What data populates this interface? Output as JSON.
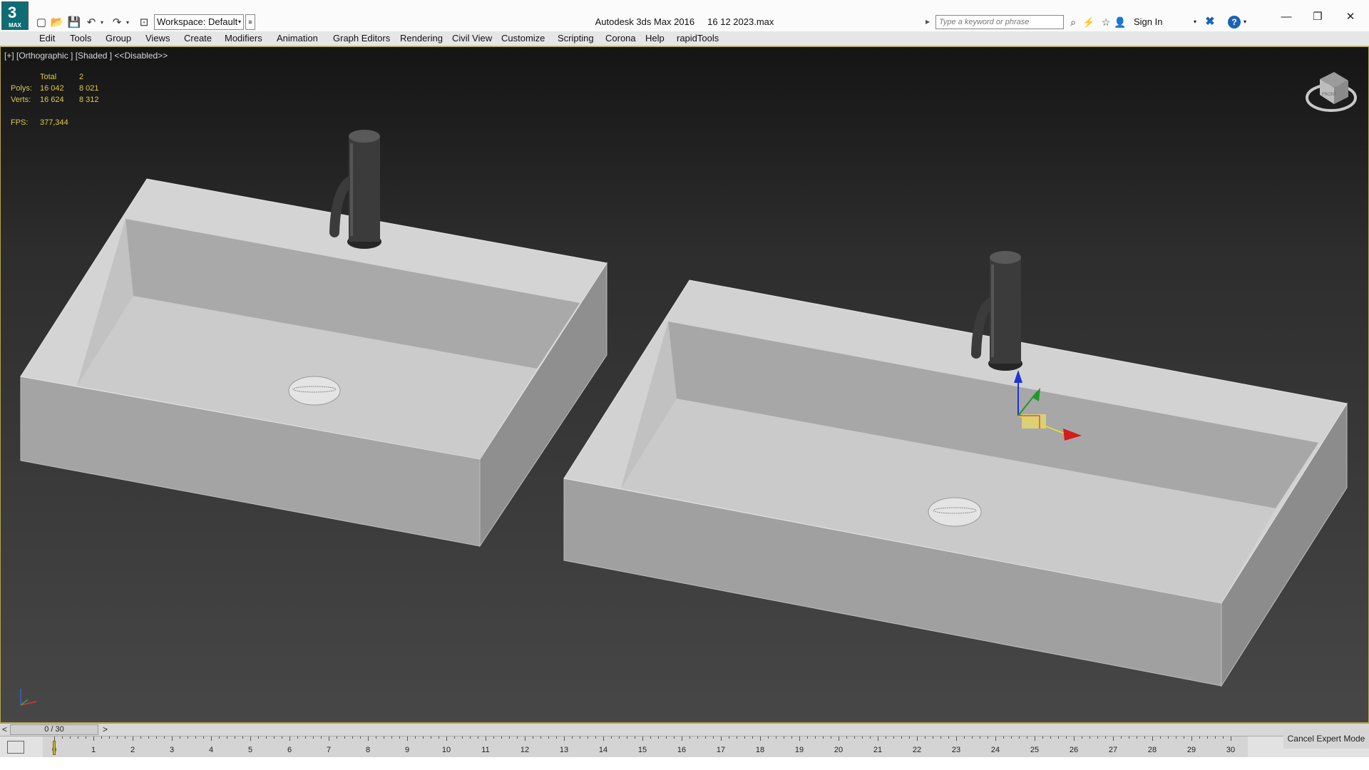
{
  "app": {
    "logo_symbol": "3",
    "logo_text": "MAX",
    "title_app": "Autodesk 3ds Max 2016",
    "title_file": "16 12 2023.max"
  },
  "quick_access": {
    "icons": [
      "new-file-icon",
      "open-file-icon",
      "save-icon",
      "undo-icon",
      "undo-dropdown-icon",
      "redo-icon",
      "redo-dropdown-icon",
      "project-folder-icon"
    ],
    "workspace_label": "Workspace: Default"
  },
  "info_center": {
    "search_placeholder": "Type a keyword or phrase",
    "sign_in": "Sign In"
  },
  "menu": [
    "Edit",
    "Tools",
    "Group",
    "Views",
    "Create",
    "Modifiers",
    "Animation",
    "Graph Editors",
    "Rendering",
    "Civil View",
    "Customize",
    "Scripting",
    "Corona",
    "Help",
    "rapidTools"
  ],
  "viewport": {
    "label": "[+] [Orthographic ] [Shaded ]  <<Disabled>>",
    "stats": {
      "total_label": "Total",
      "total_value": "2",
      "polys_label": "Polys:",
      "polys_total": "16 042",
      "polys_sel": "8 021",
      "verts_label": "Verts:",
      "verts_total": "16 624",
      "verts_sel": "8 312",
      "fps_label": "FPS:",
      "fps_value": "377,344"
    },
    "viewcube_label": "FRONT",
    "gizmo_axes": [
      "x",
      "y",
      "z"
    ]
  },
  "timeline": {
    "position": "0 / 30",
    "prev": "<",
    "next": ">",
    "frames": [
      "0",
      "1",
      "2",
      "3",
      "4",
      "5",
      "6",
      "7",
      "8",
      "9",
      "10",
      "11",
      "12",
      "13",
      "14",
      "15",
      "16",
      "17",
      "18",
      "19",
      "20",
      "21",
      "22",
      "23",
      "24",
      "25",
      "26",
      "27",
      "28",
      "29",
      "30"
    ],
    "current_frame": 0
  },
  "status": {
    "cancel_expert": "Cancel Expert Mode"
  },
  "colors": {
    "accent": "#0e6d74",
    "viewport_border": "#b9a44b",
    "stats_text": "#e0c84a",
    "gizmo_x": "#d21d1d",
    "gizmo_y": "#1e9a2b",
    "gizmo_z": "#1d33d2"
  }
}
